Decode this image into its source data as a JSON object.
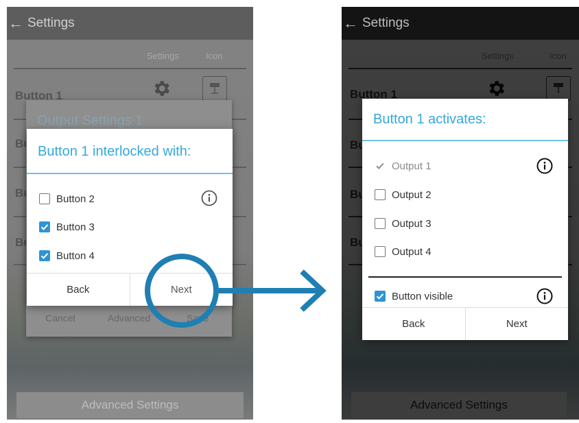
{
  "left": {
    "appbar": {
      "title": "Settings"
    },
    "columns": {
      "settings": "Settings",
      "icon": "Icon"
    },
    "rows": [
      {
        "label": "Button 1"
      },
      {
        "label": "Bu"
      },
      {
        "label": "Bu"
      },
      {
        "label": "Bu"
      }
    ],
    "background_dialog": {
      "title": "Output Settings 1",
      "cancel": "Cancel",
      "advanced": "Advanced",
      "save": "Save"
    },
    "dialog": {
      "title": "Button 1 interlocked with:",
      "options": [
        {
          "label": "Button 2",
          "checked": false
        },
        {
          "label": "Button 3",
          "checked": true
        },
        {
          "label": "Button 4",
          "checked": true
        }
      ],
      "back": "Back",
      "next": "Next"
    },
    "advanced_settings": "Advanced Settings"
  },
  "right": {
    "appbar": {
      "title": "Settings"
    },
    "columns": {
      "settings": "Settings",
      "icon": "Icon"
    },
    "rows": [
      {
        "label": "Button 1"
      },
      {
        "label": "Bu"
      },
      {
        "label": "Bu"
      },
      {
        "label": "Bu"
      }
    ],
    "dialog": {
      "title": "Button 1 activates:",
      "options": [
        {
          "label": "Output 1",
          "checked": true,
          "disabled": true
        },
        {
          "label": "Output 2",
          "checked": false
        },
        {
          "label": "Output 3",
          "checked": false
        },
        {
          "label": "Output 4",
          "checked": false
        }
      ],
      "visible": {
        "label": "Button visible",
        "checked": true
      },
      "back": "Back",
      "next": "Next"
    },
    "advanced_settings": "Advanced Settings"
  },
  "colors": {
    "accent": "#36a8d8",
    "checkbox": "#2f93d6",
    "highlight_circle": "#1f7fb3"
  }
}
